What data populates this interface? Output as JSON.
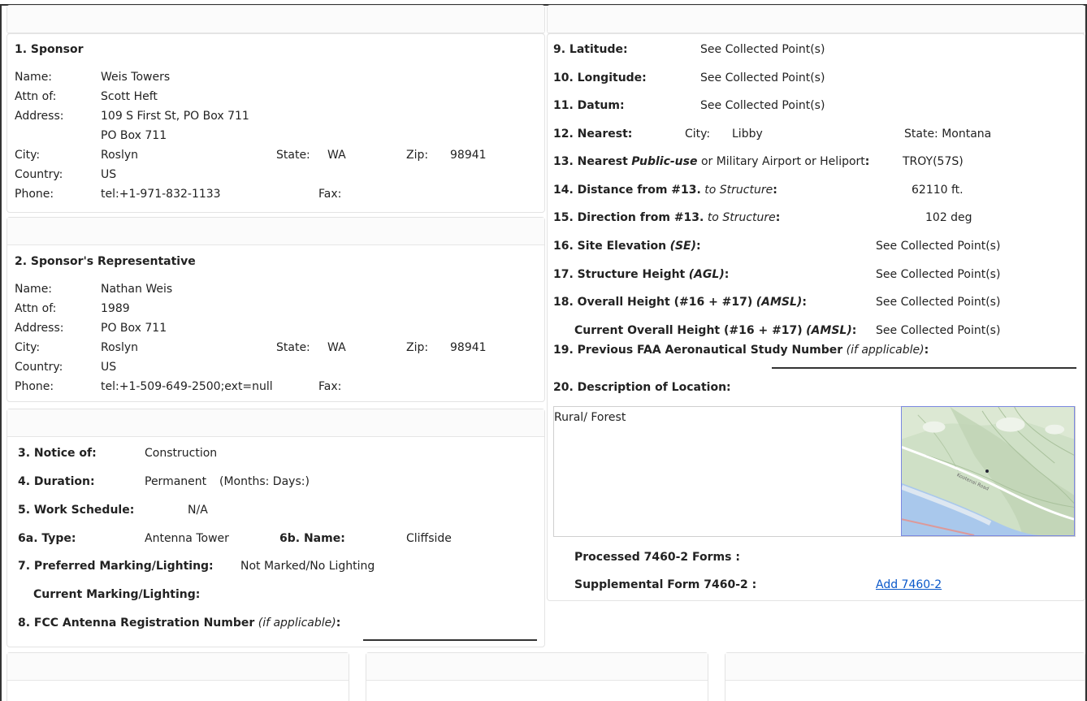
{
  "sponsor": {
    "heading": "1.  Sponsor",
    "labels": {
      "name": "Name:",
      "attn": "Attn of:",
      "address": "Address:",
      "city": "City:",
      "state": "State:",
      "zip": "Zip:",
      "country": "Country:",
      "phone": "Phone:",
      "fax": "Fax:"
    },
    "name": "Weis Towers",
    "attn": "Scott Heft",
    "address1": "109 S First St, PO Box 711",
    "address2": "PO Box 711",
    "city": "Roslyn",
    "state": "WA",
    "zip": "98941",
    "country": "US",
    "phone": "tel:+1-971-832-1133",
    "fax": ""
  },
  "representative": {
    "heading": "2.  Sponsor's Representative",
    "name": "Nathan Weis",
    "attn": "1989",
    "address1": "PO Box 711",
    "city": "Roslyn",
    "state": "WA",
    "zip": "98941",
    "country": "US",
    "phone": "tel:+1-509-649-2500;ext=null",
    "fax": ""
  },
  "notice": {
    "notice_label": "3. Notice of:",
    "notice_value": "Construction",
    "duration_label": "4. Duration:",
    "duration_value": "Permanent",
    "duration_extra": "(Months:  Days:)",
    "schedule_label": "5. Work Schedule:",
    "schedule_value": "N/A",
    "type_label": "6a. Type:",
    "type_value": "Antenna Tower",
    "name_label": "6b. Name:",
    "name_value": "Cliffside",
    "marking_label": "7. Preferred Marking/Lighting:",
    "marking_value": "Not Marked/No Lighting",
    "current_marking_label": "Current Marking/Lighting:",
    "fcc_label": "8. FCC Antenna Registration Number",
    "fcc_hint": "(if applicable)",
    "fcc_colon": ":"
  },
  "location": {
    "lat_label": "9.  Latitude:",
    "lat_value": "See Collected Point(s)",
    "lon_label": "10. Longitude:",
    "lon_value": "See Collected Point(s)",
    "datum_label": "11. Datum:",
    "datum_value": "See Collected Point(s)",
    "nearest_label": "12. Nearest:",
    "city_label": "City:",
    "city_value": "Libby",
    "state_text": "State: Montana",
    "airport_label_a": "13. Nearest",
    "airport_label_b": "Public-use",
    "airport_label_c": "or Military Airport or Heliport",
    "airport_colon": ":",
    "airport_value": "TROY(57S)",
    "distance_label": "14. Distance from #13.",
    "distance_hint": "to Structure",
    "distance_colon": ":",
    "distance_value": "62110 ft.",
    "direction_label": "15. Direction from #13.",
    "direction_hint": "to Structure",
    "direction_colon": ":",
    "direction_value": "102 deg",
    "elev_label": "16. Site Elevation",
    "elev_hint": "(SE)",
    "elev_colon": ":",
    "elev_value": "See Collected Point(s)",
    "height_label": "17. Structure Height",
    "height_hint": "(AGL)",
    "height_colon": ":",
    "height_value": "See Collected Point(s)",
    "overall_label": "18. Overall Height (#16 + #17)",
    "overall_hint": "(AMSL)",
    "overall_colon": ":",
    "overall_value": "See Collected Point(s)",
    "current_overall_label": "Current Overall Height (#16 + #17)",
    "current_overall_hint": "(AMSL)",
    "current_overall_colon": ":",
    "current_overall_value": "See Collected Point(s)",
    "prev_study_label": "19. Previous FAA Aeronautical Study Number",
    "prev_study_hint": "(if applicable)",
    "prev_study_colon": ":",
    "desc_label": "20. Description of Location:",
    "desc_value": "Rural/ Forest",
    "map_road_label": "Kootenai Road",
    "processed_label": "Processed 7460-2 Forms :",
    "supplemental_label": "Supplemental Form 7460-2 :",
    "add_link": "Add 7460-2"
  }
}
